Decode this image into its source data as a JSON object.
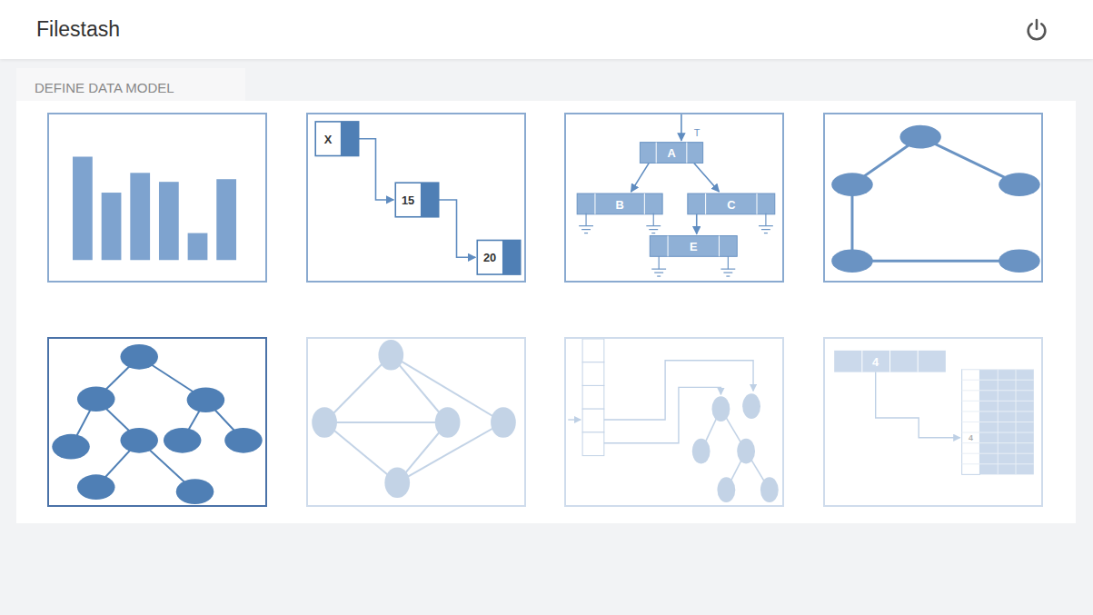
{
  "header": {
    "title": "Filestash"
  },
  "section": {
    "label": "DEFINE DATA MODEL"
  },
  "models": [
    {
      "kind": "bar-chart",
      "disabled": false,
      "selected": false,
      "values": [
        115,
        75,
        97,
        87,
        30,
        90
      ]
    },
    {
      "kind": "linked-list",
      "disabled": false,
      "selected": false,
      "nodes": [
        "X",
        "15",
        "20"
      ]
    },
    {
      "kind": "node-tree",
      "disabled": false,
      "selected": false,
      "pointer": "T",
      "nodes": [
        "A",
        "B",
        "C",
        "E"
      ]
    },
    {
      "kind": "cycle-graph",
      "disabled": false,
      "selected": false
    },
    {
      "kind": "binary-tree",
      "disabled": false,
      "selected": true
    },
    {
      "kind": "graph",
      "disabled": true,
      "selected": false
    },
    {
      "kind": "hash-tree",
      "disabled": true,
      "selected": false
    },
    {
      "kind": "hash-table",
      "disabled": true,
      "selected": false,
      "key": "4",
      "slot": "4"
    }
  ]
}
